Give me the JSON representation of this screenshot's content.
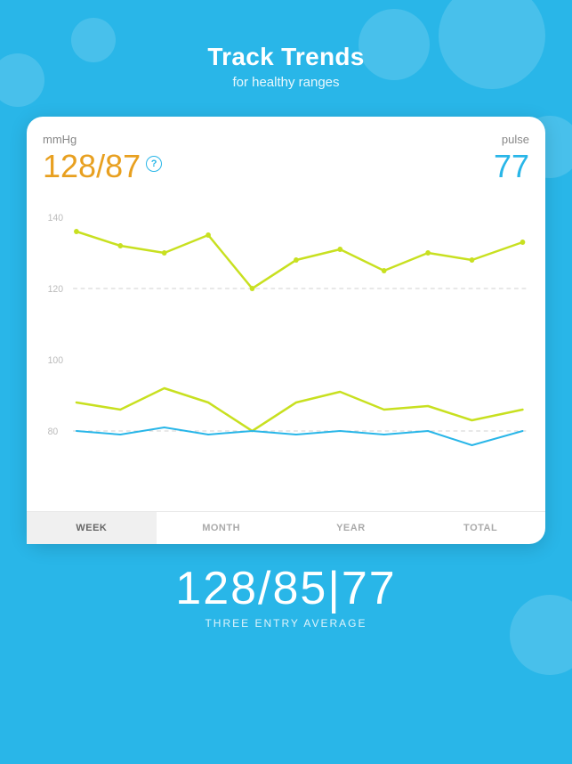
{
  "header": {
    "title": "Track Trends",
    "subtitle": "for healthy ranges"
  },
  "card": {
    "mmhg_unit": "mmHg",
    "pulse_unit": "pulse",
    "blood_pressure": "128/87",
    "pulse_value": "77",
    "chart": {
      "y_labels": [
        "140",
        "120",
        "100",
        "80"
      ],
      "systolic_line": [
        136,
        132,
        130,
        135,
        120,
        128,
        131,
        125,
        130,
        128,
        133
      ],
      "diastolic_line": [
        88,
        86,
        92,
        88,
        80,
        88,
        91,
        86,
        87,
        83,
        86
      ],
      "pulse_line": [
        80,
        80,
        81,
        79,
        80,
        79,
        80,
        79,
        80,
        76,
        80
      ]
    },
    "tabs": [
      "WEEK",
      "MONTH",
      "YEAR",
      "TOTAL"
    ],
    "active_tab": "WEEK"
  },
  "bottom": {
    "reading": "128/85|77",
    "label": "THREE ENTRY AVERAGE"
  },
  "icons": {
    "question": "?"
  }
}
